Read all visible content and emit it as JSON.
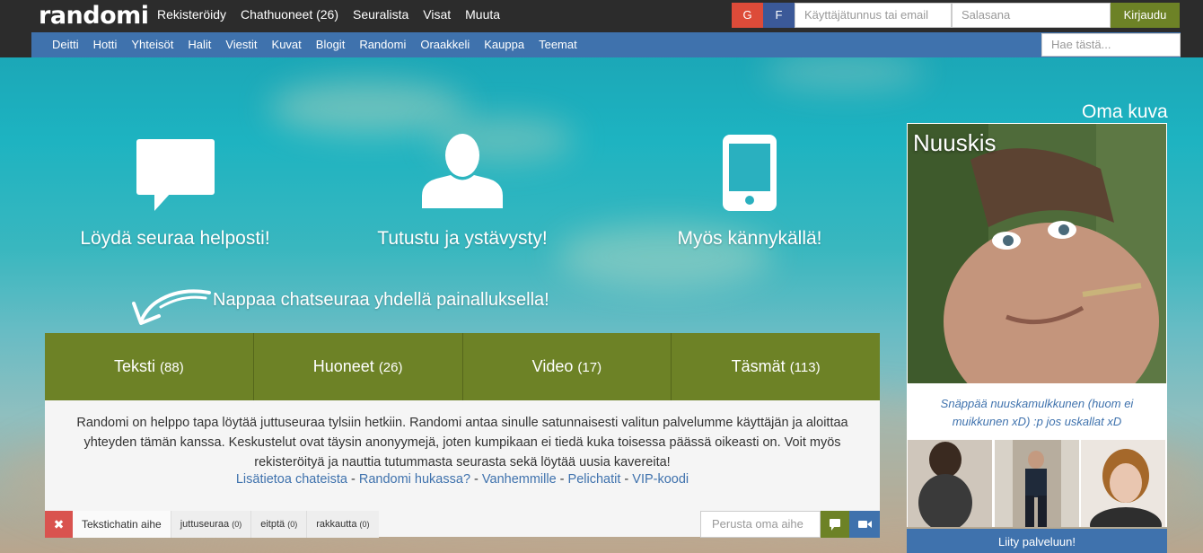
{
  "brand": {
    "logo": "randomi"
  },
  "topnav": {
    "items": [
      "Rekisteröidy",
      "Chathuoneet (26)",
      "Seuralista",
      "Visat",
      "Muuta"
    ]
  },
  "login": {
    "google_label": "G",
    "facebook_label": "F",
    "username_placeholder": "Käyttäjätunnus tai email",
    "password_placeholder": "Salasana",
    "login_label": "Kirjaudu"
  },
  "subnav": {
    "items": [
      "Deitti",
      "Hotti",
      "Yhteisöt",
      "Halit",
      "Viestit",
      "Kuvat",
      "Blogit",
      "Randomi",
      "Oraakkeli",
      "Kauppa",
      "Teemat"
    ],
    "search_placeholder": "Hae tästä..."
  },
  "features": [
    {
      "icon": "chat-bubble-icon",
      "label": "Löydä seuraa helposti!"
    },
    {
      "icon": "person-icon",
      "label": "Tutustu ja ystävysty!"
    },
    {
      "icon": "mobile-phone-icon",
      "label": "Myös kännykällä!"
    }
  ],
  "tagline": "Nappaa chatseuraa yhdellä painalluksella!",
  "tabs": [
    {
      "label": "Teksti",
      "count": "(88)"
    },
    {
      "label": "Huoneet",
      "count": "(26)"
    },
    {
      "label": "Video",
      "count": "(17)"
    },
    {
      "label": "Täsmät",
      "count": "(113)"
    }
  ],
  "description": "Randomi on helppo tapa löytää juttuseuraa tylsiin hetkiin. Randomi antaa sinulle satunnaisesti valitun palvelumme käyttäjän ja aloittaa yhteyden tämän kanssa. Keskustelut ovat täysin anonyymejä, joten kumpikaan ei tiedä kuka toisessa päässä oikeasti on. Voit myös rekisteröityä ja nauttia tutummasta seurasta sekä löytää uusia kavereita!",
  "info_links": [
    "Lisätietoa chateista",
    "Randomi hukassa?",
    "Vanhemmille",
    "Pelichatit",
    "VIP-koodi"
  ],
  "link_separator": " - ",
  "topics": {
    "close_label": "✖",
    "label": "Tekstichatin aihe",
    "items": [
      {
        "name": "juttuseuraa",
        "count": "(0)"
      },
      {
        "name": "eitptä",
        "count": "(0)"
      },
      {
        "name": "rakkautta",
        "count": "(0)"
      }
    ],
    "own_topic_placeholder": "Perusta oma aihe"
  },
  "sidebar": {
    "title": "Oma kuva",
    "profile_name": "Nuuskis",
    "caption": "Snäppää nuuskamulkkunen (huom ei muikkunen xD) :p jos uskallat xD",
    "join_label": "Liity palveluun!"
  },
  "colors": {
    "topbar": "#2c2c2c",
    "accent_green": "#6d8226",
    "accent_blue": "#3f72ad",
    "google_red": "#dd4b39",
    "facebook_blue": "#3b5998"
  }
}
